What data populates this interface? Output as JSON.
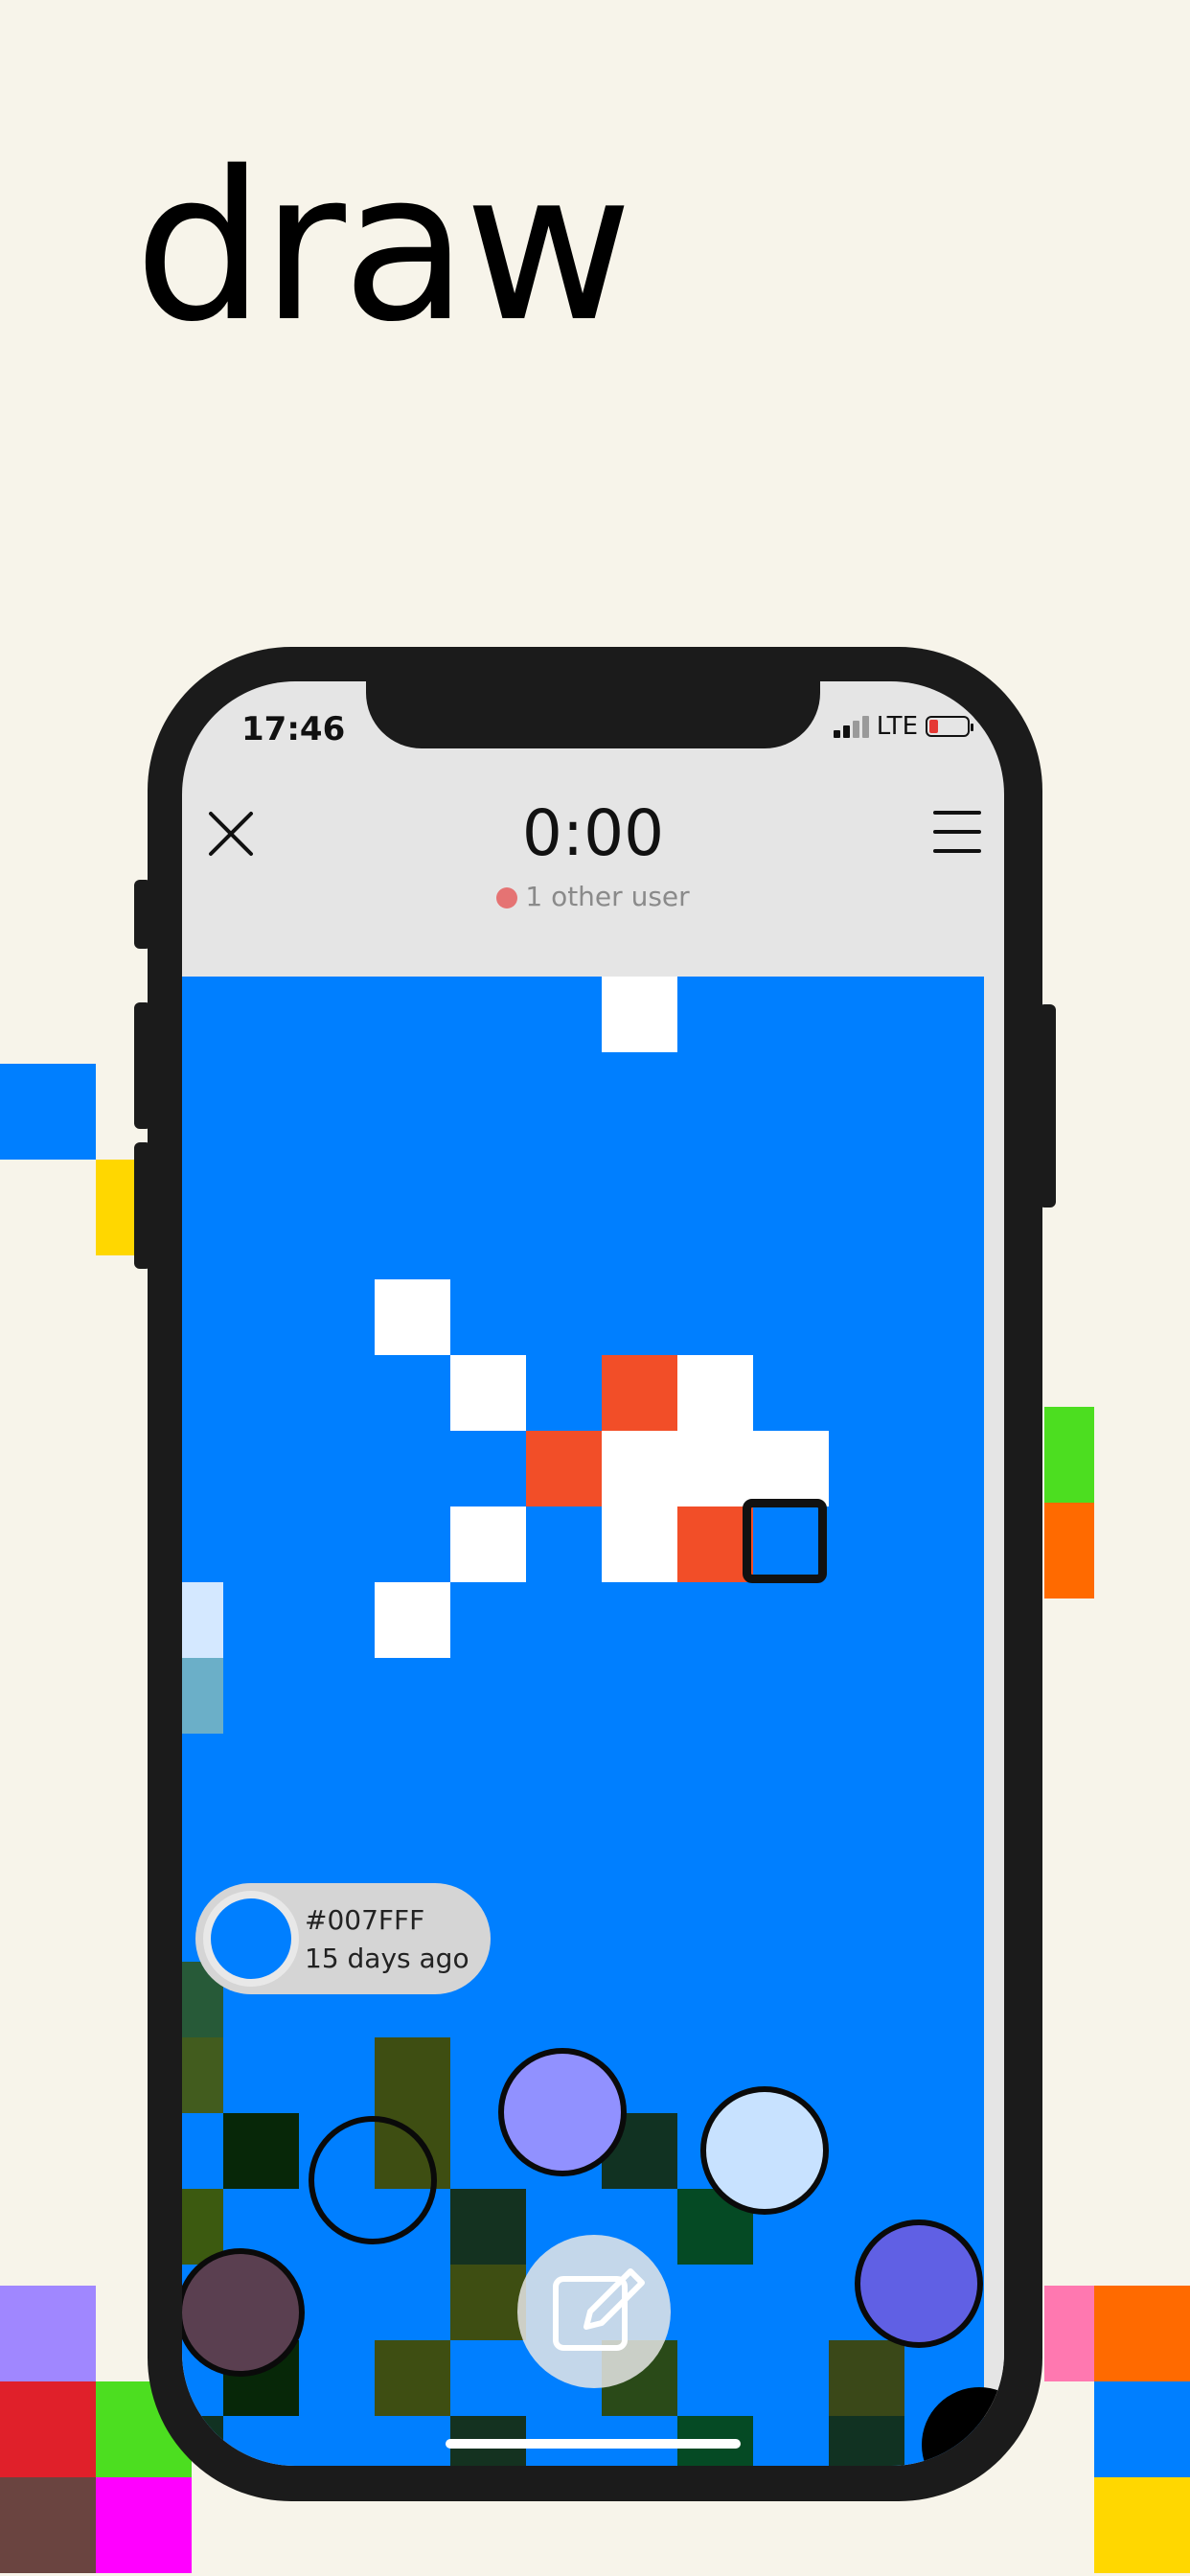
{
  "hero": {
    "title": "draw"
  },
  "status": {
    "time": "17:46",
    "network": "LTE"
  },
  "header": {
    "timer": "0:00",
    "users_label": "1 other user"
  },
  "swatch": {
    "hex": "#007FFF",
    "age": "15 days ago"
  },
  "colors": {
    "canvas": "#007FFF",
    "background": "#F7F4EA",
    "accent_red": "#F24E28",
    "user_dot": "#E57373"
  },
  "icons": {
    "close": "close-icon",
    "menu": "menu-icon",
    "edit": "edit-icon"
  }
}
